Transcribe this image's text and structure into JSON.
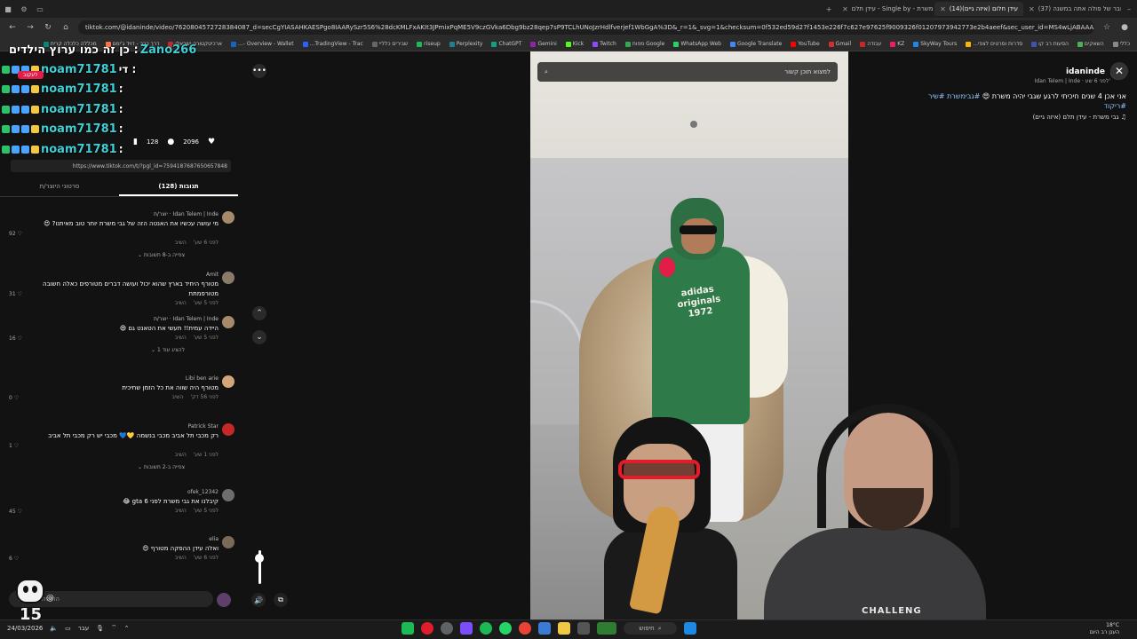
{
  "browser": {
    "tabs": [
      {
        "label": "(37) חבר של פולה אתה במשנה",
        "active": false
      },
      {
        "label": "(14)עידן חלום (איזה גיים)",
        "active": true
      },
      {
        "label": "עידן תלם - Single by - גבי משרת",
        "active": false
      }
    ],
    "url": "tiktok.com/@idaninde/video/7620804572728384087_d=secCgYIASAHKAESPgo8IAARySzr5S6%28dcKMLFxAKIt3JPmixPqME5V9czGVka6Dbg9bz28qep7sP9TCLhUNoJzrHdlfverjef1WbGgA%3D&_r=1&_svg=1&checksum=0f532ed59d27f1453e226f7c627e97625f9009326f01207973942773e2b4aeef&sec_user_id=MS4wLjABAAAAGerC...",
    "bookmarks": [
      "כללי",
      "השאקים",
      "הסעות רב קו",
      "סדרות וסרטים לצפי...",
      "SkyWay Tours",
      "KZ",
      "עבודה",
      "Gmail",
      "YouTube",
      "Google Translate",
      "WhatsApp Web",
      "Google מפות",
      "Twitch",
      "Kick",
      "Gemini",
      "ChatGPT",
      "Perplexity",
      "riseup",
      "שבירים כלליי",
      "TradingView - Trac...",
      "Overview - Wallet -...",
      "ארכיטקטורה ישראלי",
      "דרך כבר - דויד ג'ימם",
      "מכללה כלכלה קרית"
    ]
  },
  "overlay_chat": {
    "header": "כן זה כמו ערוץ הילדים :",
    "header_user": "Zano266",
    "follow_badge": "לעקוב",
    "lines": [
      {
        "user": "noam71781",
        "msg": "די :"
      },
      {
        "user": "noam71781",
        "msg": ":"
      },
      {
        "user": "noam71781",
        "msg": ":"
      },
      {
        "user": "noam71781",
        "msg": ":"
      },
      {
        "user": "noam71781",
        "msg": ":"
      }
    ]
  },
  "post": {
    "author_handle": "idaninde",
    "author_name": "Idan Telem | Inde",
    "time_ago": "לפני 6 שע'",
    "description": "אני אכן 4 שנים חיכיתי לרגע שגבי יהיה משרת 😍",
    "hashtags": "#גבימשרת #שיר #ריקוד",
    "music": "גבי משרת - עידן תלם (איזה גיים)",
    "likes": "2096",
    "comments_count": "128",
    "share_link": "https://www.tiktok.com/t/?pgl_id=7594187687650657848",
    "tab_comments": "תגובות (128)",
    "tab_creator": "סרטוני היוצר/ת"
  },
  "comments": [
    {
      "name": "Idan Telem | Inde · יוצר/ת",
      "text": "מי עושה עכשיו את האנטה הזה של גבי משרת יותר טוב מאיתנו? 😍",
      "time": "לפני 6 שע'",
      "reply": "השיב",
      "likes": "92",
      "more": "צפייה ב-8 תשובות"
    },
    {
      "name": "Amit",
      "text": "מטורף היחיד בארץ שהוא יכול ועושה דברים מטורפים כאלה חשובה מטורפמתת",
      "time": "לפני 5 שע'",
      "reply": "השיב",
      "likes": "31",
      "more": ""
    },
    {
      "name": "Idan Telem | Inde · יוצר/ת",
      "text": "היידה עמית!! תעשי את הטאנט גם 😄",
      "time": "לפני 5 שע'",
      "reply": "השיב",
      "likes": "16",
      "more": "להציג עוד 1"
    },
    {
      "name": "Libi ben arie",
      "text": "מטורף היה שווה את כל הזמן שחיכית",
      "time": "לפני 56 דק'",
      "reply": "השיב",
      "likes": "0",
      "more": ""
    },
    {
      "name": "Patrick Star",
      "text": "רק מכבי תל אביב מכבי בנשמה 💛💙 מכבי יש רק מכבי תל אביב",
      "time": "לפני 1 שע'",
      "reply": "השיב",
      "likes": "1",
      "more": "צפייה ב-2 תשובות"
    },
    {
      "name": "ofek_12342",
      "text": "קיבלנו את גבי משרת לפני 6 gta 😂",
      "time": "לפני 5 שע'",
      "reply": "השיב",
      "likes": "45",
      "more": ""
    },
    {
      "name": "elia",
      "text": "ואלה עידן ההפקה מטורף 😍",
      "time": "לפני 6 שע'",
      "reply": "השיב",
      "likes": "6",
      "more": ""
    }
  ],
  "input": {
    "placeholder": "הוספת תגובה..."
  },
  "video": {
    "search_placeholder": "למצוא תוכן קשור",
    "shirt_text": "adidas originals 1972",
    "streamer_shirt": "CHALLENG"
  },
  "mascot_text": "15",
  "taskbar": {
    "search_label": "חיפוש",
    "clock_time": "24/03/2026",
    "weather": "18°C",
    "weather_desc": "הענן רב היום",
    "lang": "עבר"
  }
}
